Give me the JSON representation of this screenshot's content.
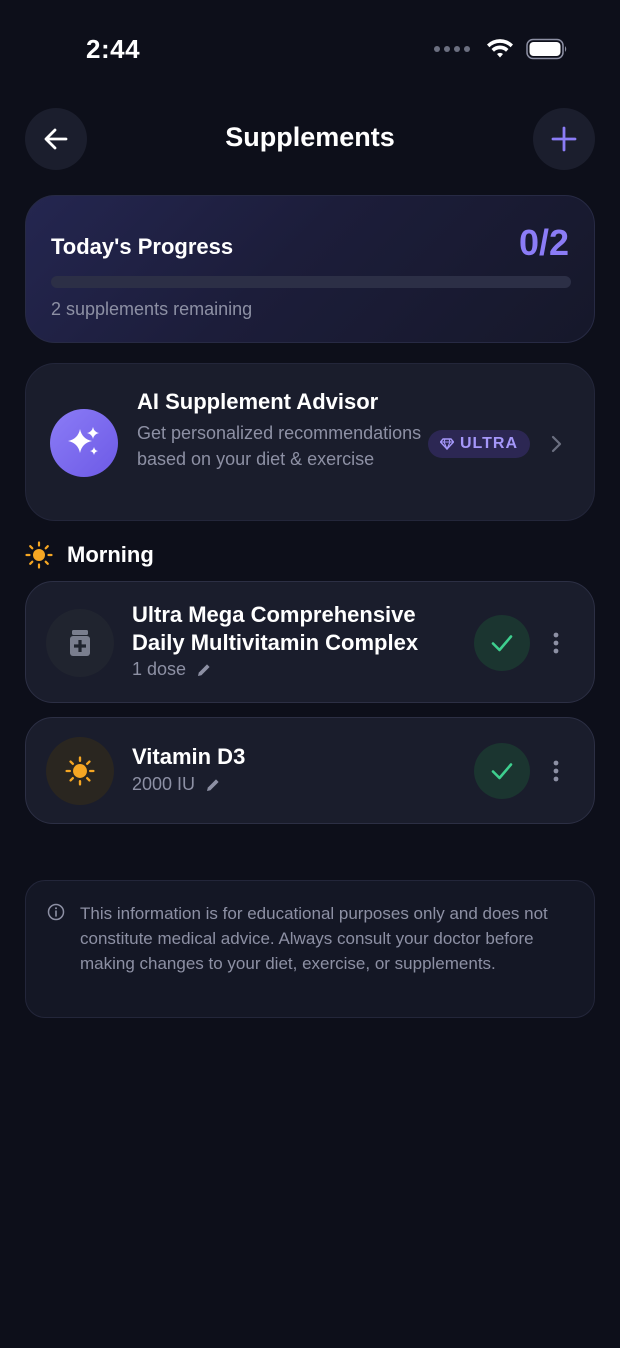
{
  "status_bar": {
    "time": "2:44"
  },
  "header": {
    "title": "Supplements"
  },
  "progress": {
    "title": "Today's Progress",
    "count": "0/2",
    "fraction": 0,
    "remaining": "2 supplements remaining"
  },
  "advisor": {
    "title": "AI Supplement Advisor",
    "description": "Get personalized recommendations based on your diet & exercise",
    "badge": "ULTRA"
  },
  "section": {
    "title": "Morning"
  },
  "supplements": [
    {
      "name": "Ultra Mega Comprehensive Daily Multivitamin Complex",
      "dose": "1 dose",
      "icon": "pill-bottle-icon"
    },
    {
      "name": "Vitamin D3",
      "dose": "2000 IU",
      "icon": "sun-icon"
    }
  ],
  "disclaimer": {
    "text": "This information is for educational purposes only and does not constitute medical advice. Always consult your doctor before making changes to your diet, exercise, or supplements."
  },
  "colors": {
    "background": "#0d0f1a",
    "accent": "#8b7cf6",
    "success": "#3ecf8e",
    "sun": "#f5a623",
    "card": "#1a1d2c"
  }
}
